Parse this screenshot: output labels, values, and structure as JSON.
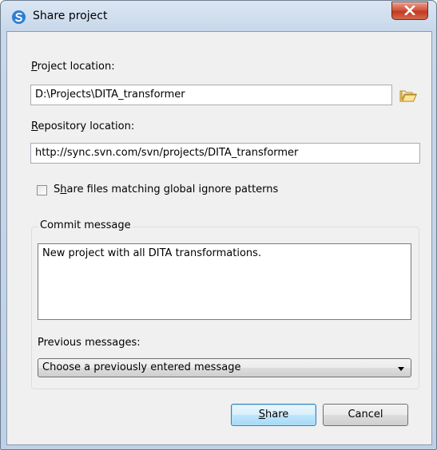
{
  "window": {
    "title": "Share project"
  },
  "project_location": {
    "label": "Project location:",
    "mnemonic": "P",
    "label_rest": "roject location:",
    "value": "D:\\Projects\\DITA_transformer"
  },
  "repository_location": {
    "label": "Repository location:",
    "mnemonic": "R",
    "label_rest": "epository location:",
    "value": "http://sync.svn.com/svn/projects/DITA_transformer"
  },
  "share_ignore": {
    "label": "Share files matching global ignore patterns",
    "pre": "S",
    "mnemonic": "h",
    "rest": "are files matching global ignore patterns",
    "checked": false
  },
  "commit": {
    "group_title": "Commit message",
    "message": "New project with all DITA transformations.",
    "previous_label": "Previous messages:",
    "previous_selected": "Choose a previously entered message"
  },
  "buttons": {
    "share": "Share",
    "share_mnemonic": "S",
    "share_rest": "hare",
    "cancel": "Cancel"
  },
  "colors": {
    "accent": "#3c7fb1",
    "close": "#c23a22"
  },
  "icons": {
    "app": "sync-app-icon",
    "folder": "folder-open-icon",
    "close": "close-icon",
    "dropdown": "chevron-down-icon"
  }
}
